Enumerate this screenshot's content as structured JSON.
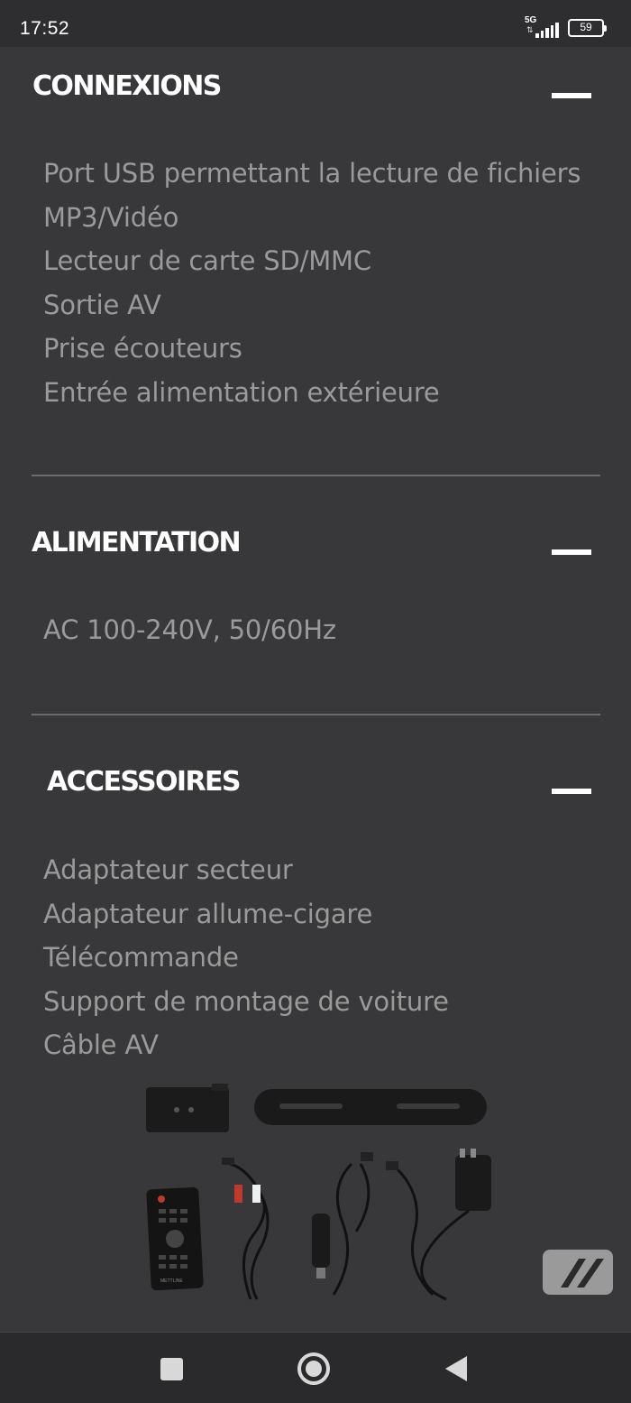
{
  "status_bar": {
    "time": "17:52",
    "network": "5G",
    "network_arrows": "⇅",
    "battery": "59"
  },
  "sections": [
    {
      "title": "CONNEXIONS",
      "items": [
        "Port USB permettant la lecture de fichiers",
        "MP3/Vidéo",
        "Lecteur de carte SD/MMC",
        "Sortie AV",
        "Prise écouteurs",
        "Entrée alimentation extérieure"
      ]
    },
    {
      "title": "ALIMENTATION",
      "items": [
        "AC 100-240V, 50/60Hz"
      ]
    },
    {
      "title": "ACCESSOIRES",
      "items": [
        "Adaptateur secteur",
        "Adaptateur allume-cigare",
        "Télécommande",
        "Support de montage de voiture",
        "Câble AV"
      ]
    }
  ],
  "product_image": {
    "remote_brand": "METTLINE"
  },
  "icons": {
    "collapse": "minus-icon",
    "nav_recents": "square-icon",
    "nav_home": "circle-icon",
    "nav_back": "triangle-left-icon"
  }
}
